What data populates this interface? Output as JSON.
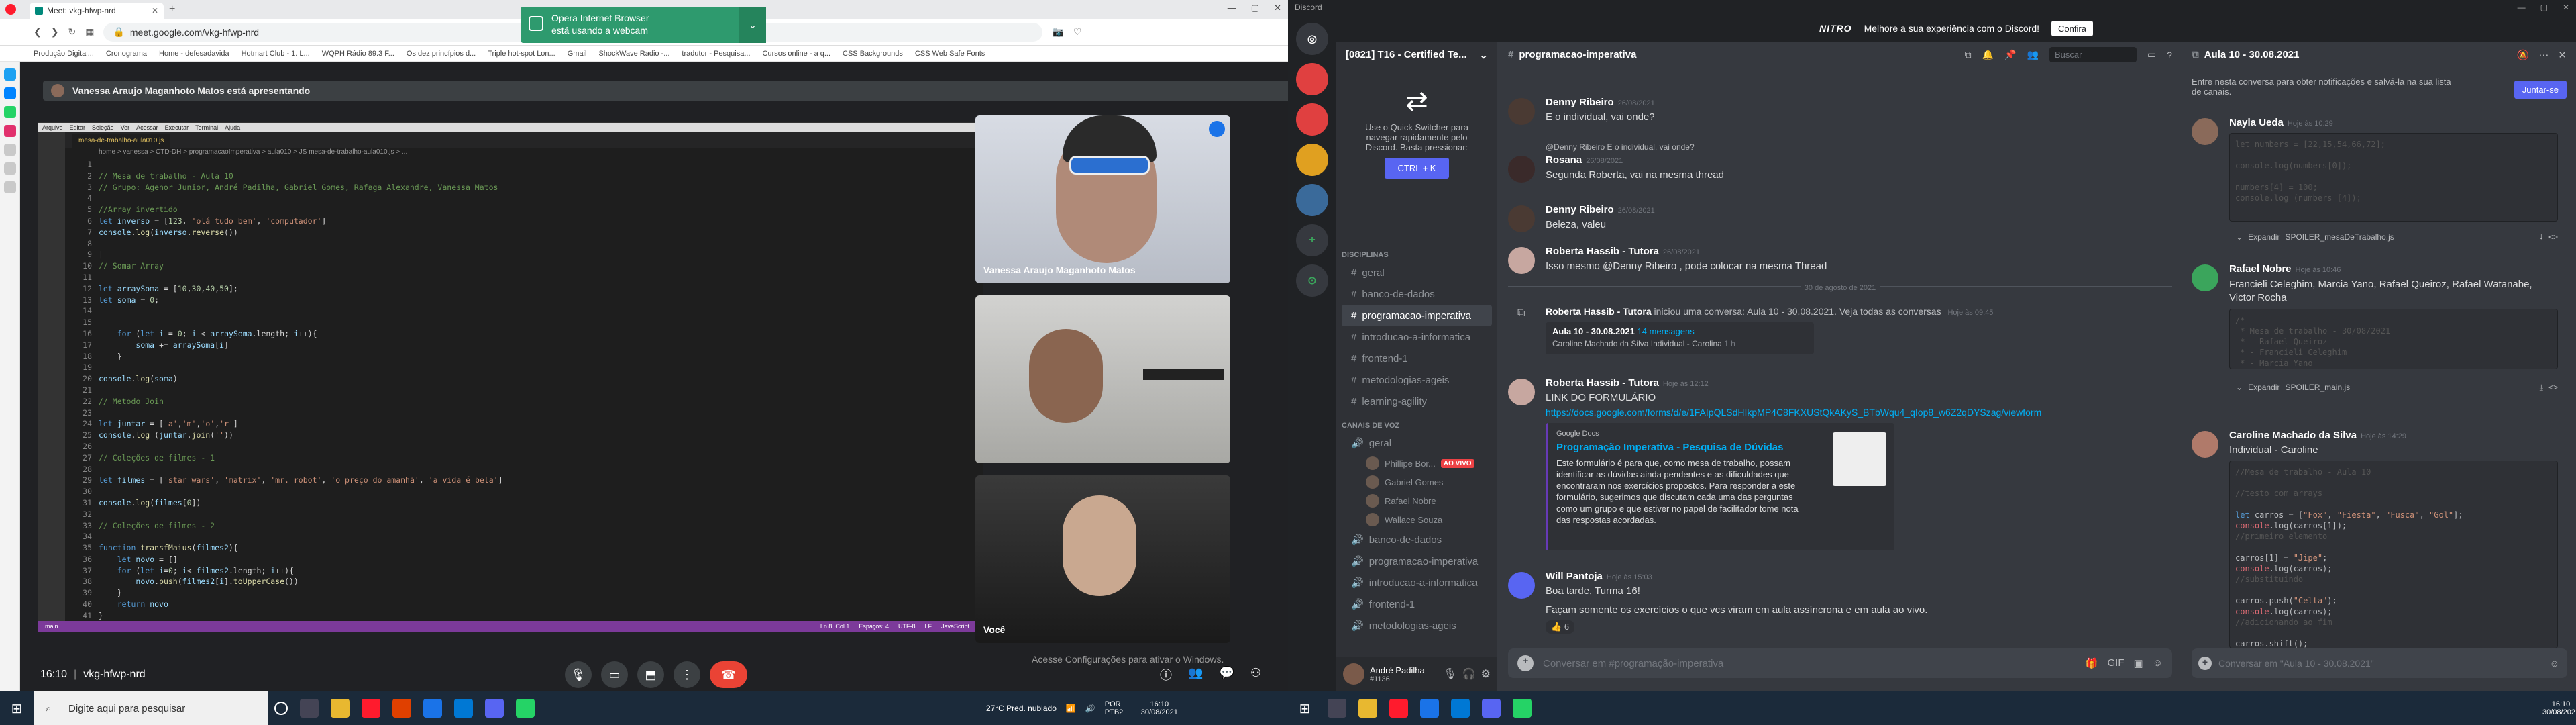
{
  "browser": {
    "tab_title": "Meet: vkg-hfwp-nrd",
    "url": "meet.google.com/vkg-hfwp-nrd",
    "bookmarks": [
      "Produção Digital...",
      "Cronograma",
      "Home - defesadavida",
      "Hotmart Club - 1. L...",
      "WQPH Rádio 89.3 F...",
      "Os dez princípios d...",
      "Triple hot-spot Lon...",
      "Gmail",
      "ShockWave Radio -...",
      "tradutor - Pesquisa...",
      "Cursos online - a q...",
      "CSS Backgrounds",
      "CSS Web Safe Fonts"
    ],
    "notification_line1": "Opera Internet Browser",
    "notification_line2": "está usando a webcam"
  },
  "meet": {
    "presenting_banner": "Vanessa Araujo Maganhoto Matos está apresentando",
    "tiles": [
      {
        "name": "Vanessa Araujo Maganhoto Matos"
      },
      {
        "name": ""
      },
      {
        "name": "Você"
      }
    ],
    "time": "16:10",
    "meeting_code": "vkg-hfwp-nrd",
    "activate_windows": "Acesse Configurações para ativar o Windows."
  },
  "vscode": {
    "menu": [
      "Arquivo",
      "Editar",
      "Seleção",
      "Ver",
      "Acessar",
      "Executar",
      "Terminal",
      "Ajuda"
    ],
    "tab": "mesa-de-trabalho-aula010.js",
    "breadcrumb": "home > vanessa > CTD-DH > programacaoImperativa > aula010 > JS mesa-de-trabalho-aula010.js > ...",
    "status_left": "main",
    "status_right": [
      "Ln 8, Col 1",
      "Espaços: 4",
      "UTF-8",
      "LF",
      "JavaScript"
    ]
  },
  "discord": {
    "app_title": "Discord",
    "nitro_text": "Melhore a sua experiência com o Discord!",
    "nitro_button": "Confira",
    "nitro_logo": "NITRO",
    "server_name": "[0821] T16 - Certified Te...",
    "quick_switcher": "Use o Quick Switcher para navegar rapidamente pelo Discord. Basta pressionar:",
    "quick_key": "CTRL + K",
    "categories": {
      "text": "DISCIPLINAS",
      "voice": "CANAIS DE VOZ"
    },
    "text_channels": [
      "geral",
      "banco-de-dados",
      "programacao-imperativa",
      "introducao-a-informatica",
      "frontend-1",
      "metodologias-ageis",
      "learning-agility"
    ],
    "voice_channel": "geral",
    "voice_users": [
      "Phillipe Bor...",
      "Gabriel Gomes",
      "Rafael Nobre",
      "Wallace Souza"
    ],
    "live_badge": "AO VIVO",
    "voice_channels_more": [
      "banco-de-dados",
      "programacao-imperativa",
      "introducao-a-informatica",
      "frontend-1",
      "metodologias-ageis"
    ],
    "user": {
      "name": "André Padilha",
      "tag": "#1136"
    },
    "channel_header": "programacao-imperativa",
    "search_placeholder": "Buscar",
    "messages": [
      {
        "author": "Denny Ribeiro",
        "time": "26/08/2021",
        "text": "E o individual, vai onde?"
      },
      {
        "author": "Rosana",
        "time": "26/08/2021",
        "reply": "@Denny Ribeiro E o individual, vai onde?",
        "text": "Segunda Roberta, vai na mesma thread"
      },
      {
        "author": "Denny Ribeiro",
        "time": "26/08/2021",
        "text": "Beleza, valeu"
      },
      {
        "author": "Roberta Hassib - Tutora",
        "time": "26/08/2021",
        "text": "Isso mesmo @Denny Ribeiro , pode colocar na mesma Thread"
      },
      {
        "author": "Roberta Hassib - Tutora",
        "time": "Hoje às 09:45",
        "text": "iniciou uma conversa: Aula 10 - 30.08.2021. Veja todas as conversas"
      },
      {
        "author": "Roberta Hassib - Tutora",
        "time": "Hoje às 12:12",
        "text": "LINK DO FORMULÁRIO"
      },
      {
        "author": "Will Pantoja",
        "time": "Hoje às 15:03",
        "text": "Boa tarde, Turma 16!"
      }
    ],
    "date_divider": "30 de agosto de 2021",
    "thread_card": {
      "title": "Aula 10 - 30.08.2021",
      "count": "14 mensagens",
      "last": "Caroline Machado da Silva Individual - Carolina",
      "ago": "1 h"
    },
    "form_link": "https://docs.google.com/forms/d/e/1FAIpQLSdHIkpMP4C8FKXUStQkAKyS_BTbWqu4_qIop8_w6Z2qDYSzag/viewform",
    "embed": {
      "provider": "Google Docs",
      "title": "Programação Imperativa - Pesquisa de Dúvidas",
      "description": "Este formulário é para que, como mesa de trabalho, possam identificar as dúvidas ainda pendentes e as dificuldades que encontraram nos exercícios propostos. Para responder a este formulário, sugerimos que discutam cada uma das perguntas como um grupo e que estiver no papel de facilitador tome nota das respostas acordadas."
    },
    "will_line2": "Façam somente os exercícios o que vcs viram em aula assíncrona e em aula ao vivo.",
    "reaction": "6",
    "input_placeholder": "Conversar em #programação-imperativa",
    "thread": {
      "title": "Aula 10 - 30.08.2021",
      "join_text": "Entre nesta conversa para obter notificações e salvá-la na sua lista de canais.",
      "join_button": "Juntar-se",
      "msg1_author": "Nayla Ueda",
      "msg1_time": "Hoje às 10:29",
      "expand": "Expandir",
      "spoiler1": "SPOILER_mesaDeTrabalho.js",
      "msg2_author": "Rafael Nobre",
      "msg2_time": "Hoje às 10:46",
      "msg2_text": "Francieli Celeghim, Marcia Yano, Rafael Queiroz, Rafael Watanabe, Victor Rocha",
      "spoiler2": "SPOILER_main.js",
      "msg3_author": "Caroline Machado da Silva",
      "msg3_time": "Hoje às 14:29",
      "msg3_text": "Individual - Caroline",
      "input_placeholder": "Conversar em \"Aula 10 - 30.08.2021\""
    }
  },
  "taskbar": {
    "search_placeholder": "Digite aqui para pesquisar",
    "weather": "27°C  Pred. nublado",
    "lang": "POR PTB2",
    "time": "16:10",
    "date": "30/08/2021"
  },
  "colors": {
    "discord_blurple": "#5865f2",
    "meet_red": "#ea4335",
    "vscode_status": "#7c3a9a",
    "opera_green": "#2e9a6e"
  }
}
